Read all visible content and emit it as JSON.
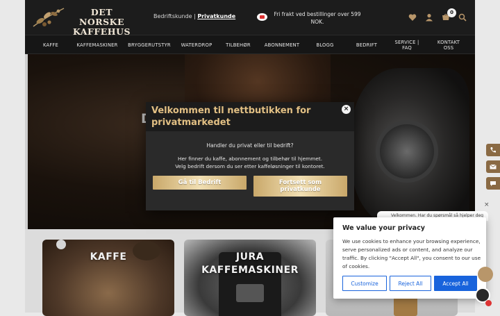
{
  "brand": {
    "line1": "DET NORSKE",
    "line2": "KAFFEHUS"
  },
  "customer_type": {
    "business": "Bedriftskunde",
    "separator": "|",
    "private": "Privatkunde"
  },
  "shipping": {
    "text": "Fri frakt ved bestillinger over 599 NOK."
  },
  "cart": {
    "count": "0"
  },
  "nav": [
    {
      "label": "KAFFE"
    },
    {
      "label": "KAFFEMASKINER"
    },
    {
      "label": "BRYGGERUTSTYR"
    },
    {
      "label": "WATERDROP"
    },
    {
      "label": "TILBEHØR"
    },
    {
      "label": "ABONNEMENT"
    },
    {
      "label": "BLOGG"
    },
    {
      "label": "BEDRIFT"
    },
    {
      "label_line1": "SERVICE |",
      "label_line2": "FAQ"
    },
    {
      "label_line1": "KONTAKT",
      "label_line2": "OSS"
    }
  ],
  "hero": {
    "heading_start": "D",
    "heading_end": ","
  },
  "categories": [
    {
      "label": "KAFFE"
    },
    {
      "label_line1": "JURA",
      "label_line2": "KAFFEMASKINER"
    }
  ],
  "modal": {
    "title": "Velkommen til nettbutikken for privatmarkedet",
    "question": "Handler du privat eller til bedrift?",
    "desc_line1": "Her finner du kaffe, abonnement og tilbehør til hjemmet.",
    "desc_line2": "Velg bedrift dersom du ser etter kaffeløsninger til kontoret.",
    "btn_business": "Gå til Bedrift",
    "btn_private_line1": "Fortsett som",
    "btn_private_line2": "privatkunde"
  },
  "chat": {
    "preview": "Velkommen. Har du spørsmål så hjelper deg"
  },
  "cookie": {
    "title": "We value your privacy",
    "body": "We use cookies to enhance your browsing experience, serve personalized ads or content, and analyze our traffic. By clicking \"Accept All\", you consent to our use of cookies.",
    "customize": "Customize",
    "reject": "Reject All",
    "accept": "Accept All"
  },
  "colors": {
    "gold": "#e2c084",
    "cookie_blue": "#1863dc",
    "side_button": "#8a6a44"
  },
  "icons": [
    "heart-icon",
    "user-icon",
    "cart-icon",
    "search-icon",
    "phone-icon",
    "mail-icon",
    "chat-icon",
    "close-icon"
  ]
}
